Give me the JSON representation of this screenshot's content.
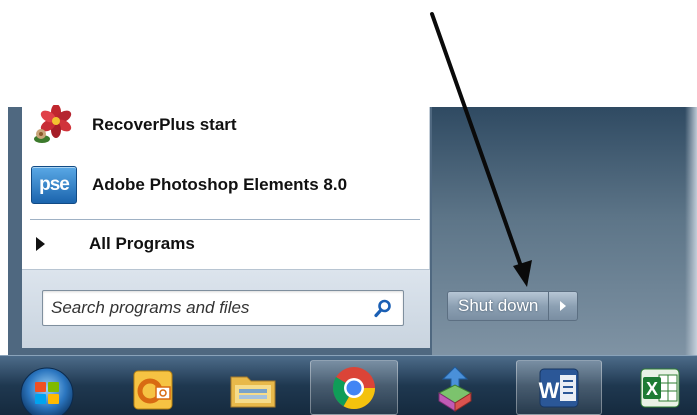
{
  "start_menu": {
    "programs": [
      {
        "label": "RecoverPlus start",
        "icon": "flower-icon"
      },
      {
        "label": "Adobe Photoshop Elements 8.0",
        "icon": "pse-icon",
        "icon_text": "pse"
      }
    ],
    "all_programs_label": "All Programs",
    "search": {
      "placeholder": "Search programs and files",
      "value": ""
    },
    "shutdown": {
      "label": "Shut down"
    }
  },
  "taskbar": {
    "items": [
      {
        "name": "start-orb",
        "icon": "windows-orb-icon"
      },
      {
        "name": "outlook",
        "icon": "outlook-icon"
      },
      {
        "name": "windows-explorer",
        "icon": "folder-icon"
      },
      {
        "name": "chrome",
        "icon": "chrome-icon"
      },
      {
        "name": "unknown-app",
        "icon": "arrows-cube-icon"
      },
      {
        "name": "word",
        "icon": "word-icon",
        "icon_text": "W"
      },
      {
        "name": "excel",
        "icon": "excel-icon",
        "icon_text": "X"
      }
    ]
  },
  "colors": {
    "panel_dark": "#2f4a62",
    "taskbar": "#1f3850",
    "search_icon": "#1a5fb4"
  }
}
